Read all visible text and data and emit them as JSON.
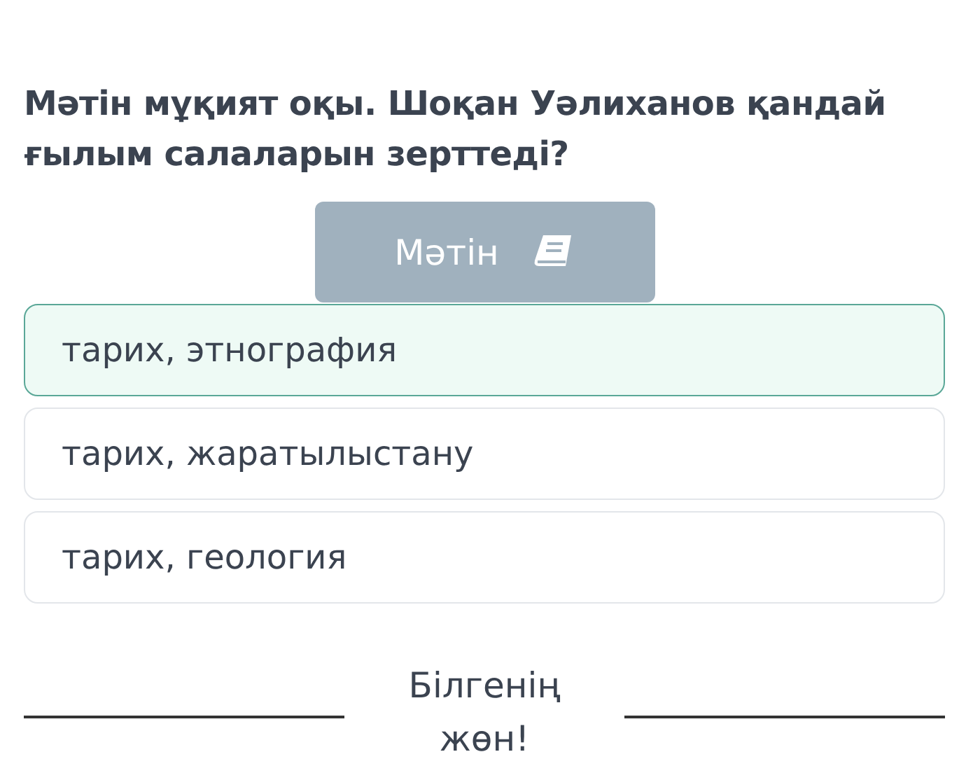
{
  "question": "Мәтін мұқият оқы. Шоқан Уәлиханов қандай ғылым салаларын зерттеді?",
  "text_button": {
    "label": "Мәтін"
  },
  "options": [
    {
      "label": "тарих, этнография",
      "selected": true
    },
    {
      "label": "тарих, жаратылыстану",
      "selected": false
    },
    {
      "label": "тарих, геология",
      "selected": false
    }
  ],
  "footer": "Білгенің жөн!"
}
